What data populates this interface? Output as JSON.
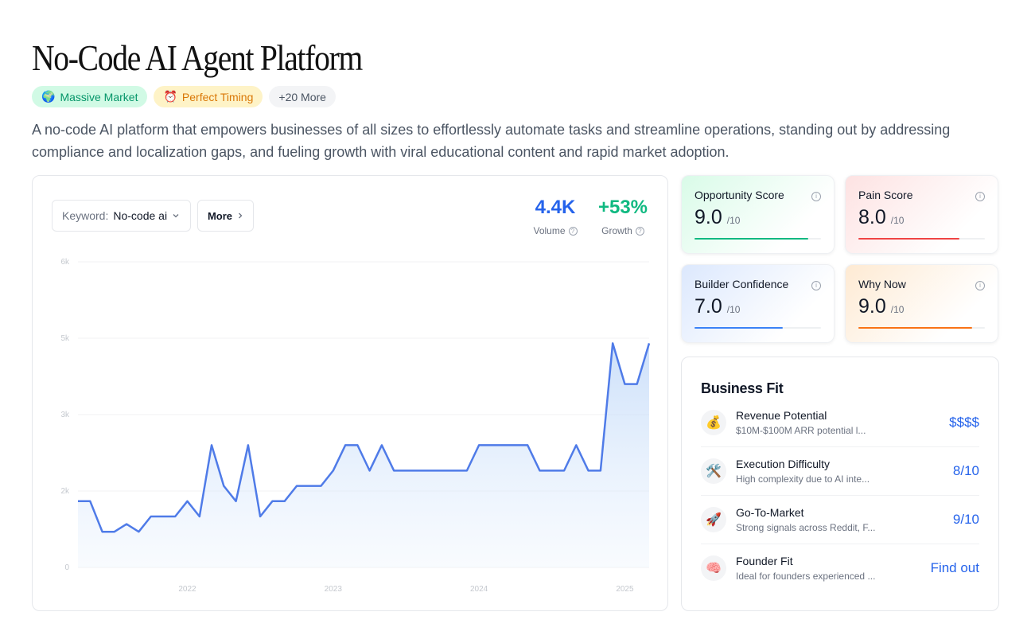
{
  "page": {
    "title": "No-Code AI Agent Platform",
    "description": "A no-code AI platform that empowers businesses of all sizes to effortlessly automate tasks and streamline operations, standing out by addressing compliance and localization gaps, and fueling growth with viral educational content and rapid market adoption."
  },
  "badges": [
    {
      "icon": "🌍",
      "icon_name": "globe-icon",
      "label": "Massive Market"
    },
    {
      "icon": "⏰",
      "icon_name": "alarm-clock-icon",
      "label": "Perfect Timing"
    },
    {
      "icon": "",
      "label": "+20 More"
    }
  ],
  "trend": {
    "keyword_label": "Keyword:",
    "keyword_value": "No-code ai",
    "more_label": "More",
    "volume_value": "4.4K",
    "volume_label": "Volume",
    "growth_value": "+53%",
    "growth_label": "Growth",
    "line_color": "#4f7be8"
  },
  "chart_data": {
    "type": "area",
    "y_ticks": [
      "0",
      "2k",
      "3k",
      "5k",
      "6k"
    ],
    "x_ticks": [
      "2022",
      "2023",
      "2024",
      "2025"
    ],
    "ylim": [
      0,
      6000
    ],
    "grid": true,
    "x": [
      "2021-04",
      "2021-05",
      "2021-06",
      "2021-07",
      "2021-08",
      "2021-09",
      "2021-10",
      "2021-11",
      "2021-12",
      "2022-01",
      "2022-02",
      "2022-03",
      "2022-04",
      "2022-05",
      "2022-06",
      "2022-07",
      "2022-08",
      "2022-09",
      "2022-10",
      "2022-11",
      "2022-12",
      "2023-01",
      "2023-02",
      "2023-03",
      "2023-04",
      "2023-05",
      "2023-06",
      "2023-07",
      "2023-08",
      "2023-09",
      "2023-10",
      "2023-11",
      "2023-12",
      "2024-01",
      "2024-02",
      "2024-03",
      "2024-04",
      "2024-05",
      "2024-06",
      "2024-07",
      "2024-08",
      "2024-09",
      "2024-10",
      "2024-11",
      "2024-12",
      "2025-01",
      "2025-02",
      "2025-03"
    ],
    "values": [
      1300,
      1300,
      700,
      700,
      850,
      700,
      1000,
      1000,
      1000,
      1300,
      1000,
      2400,
      1600,
      1300,
      2400,
      1000,
      1300,
      1300,
      1600,
      1600,
      1600,
      1900,
      2400,
      2400,
      1900,
      2400,
      1900,
      1900,
      1900,
      1900,
      1900,
      1900,
      1900,
      2400,
      2400,
      2400,
      2400,
      2400,
      1900,
      1900,
      1900,
      2400,
      1900,
      1900,
      4400,
      3600,
      3600,
      4400
    ]
  },
  "scores": {
    "opportunity": {
      "title": "Opportunity Score",
      "value": "9.0",
      "denom": "/10",
      "fraction": 0.9,
      "color": "#10b981"
    },
    "pain": {
      "title": "Pain Score",
      "value": "8.0",
      "denom": "/10",
      "fraction": 0.8,
      "color": "#ef4444"
    },
    "builder": {
      "title": "Builder Confidence",
      "value": "7.0",
      "denom": "/10",
      "fraction": 0.7,
      "color": "#3b82f6"
    },
    "why_now": {
      "title": "Why Now",
      "value": "9.0",
      "denom": "/10",
      "fraction": 0.9,
      "color": "#f97316"
    }
  },
  "business_fit": {
    "title": "Business Fit",
    "rows": [
      {
        "icon": "💰",
        "icon_name": "money-bag-icon",
        "name": "Revenue Potential",
        "sub": "$10M-$100M ARR potential l...",
        "value": "$$$$"
      },
      {
        "icon": "🛠️",
        "icon_name": "tools-icon",
        "name": "Execution Difficulty",
        "sub": "High complexity due to AI inte...",
        "value": "8/10"
      },
      {
        "icon": "🚀",
        "icon_name": "rocket-icon",
        "name": "Go-To-Market",
        "sub": "Strong signals across Reddit, F...",
        "value": "9/10"
      },
      {
        "icon": "🧠",
        "icon_name": "brain-icon",
        "name": "Founder Fit",
        "sub": "Ideal for founders experienced ...",
        "value": "Find out"
      }
    ]
  }
}
